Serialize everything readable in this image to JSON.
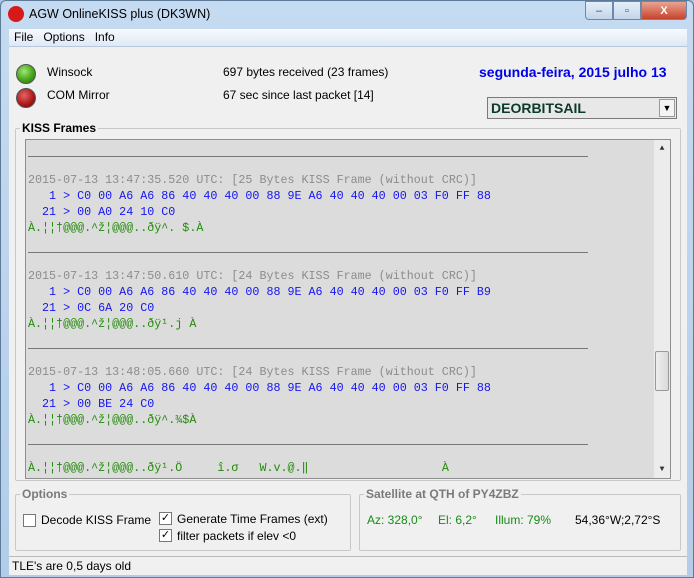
{
  "window": {
    "title": "AGW OnlineKISS plus (DK3WN)",
    "minimize": "–",
    "maximize": "▫",
    "close": "X"
  },
  "menu": [
    "File",
    "Options",
    "Info"
  ],
  "status_panel": {
    "winsock_label": "Winsock",
    "com_label": "COM Mirror",
    "bytes_received": "697 bytes received (23 frames)",
    "since_last": "67 sec since last packet [14]",
    "date": "segunda-feira, 2015 julho 13",
    "satellite_select": "DEORBITSAIL"
  },
  "kiss_frames": {
    "legend": "KISS Frames",
    "frames": [
      {
        "header": "2015-07-13 13:47:35.520 UTC: [25 Bytes KISS Frame (without CRC)]",
        "hex1": "   1 > C0 00 A6 A6 86 40 40 40 00 88 9E A6 40 40 40 00 03 F0 FF 88",
        "hex2": "  21 > 00 A0 24 10 C0",
        "ascii": "À.¦¦†@@@.^ž¦@@@..ðÿ^. $.À"
      },
      {
        "header": "2015-07-13 13:47:50.610 UTC: [24 Bytes KISS Frame (without CRC)]",
        "hex1": "   1 > C0 00 A6 A6 86 40 40 40 00 88 9E A6 40 40 40 00 03 F0 FF B9",
        "hex2": "  21 > 0C 6A 20 C0",
        "ascii": "À.¦¦†@@@.^ž¦@@@..ðÿ¹.j À"
      },
      {
        "header": "2015-07-13 13:48:05.660 UTC: [24 Bytes KISS Frame (without CRC)]",
        "hex1": "   1 > C0 00 A6 A6 86 40 40 40 00 88 9E A6 40 40 40 00 03 F0 FF 88",
        "hex2": "  21 > 00 BE 24 C0",
        "ascii": "À.¦¦†@@@.^ž¦@@@..ðÿ^.¾$À"
      }
    ],
    "partial_line": "À.¦¦†@@@.^ž¦@@@..ðÿ¹.Ö     î.σ   W.v.@.‖                   À"
  },
  "options": {
    "legend": "Options",
    "decode_kiss": {
      "label": "Decode KISS Frame",
      "checked": false
    },
    "gen_time": {
      "label": "Generate Time Frames (ext)",
      "checked": true
    },
    "filter": {
      "label": "filter packets if elev <0",
      "checked": true
    }
  },
  "satellite": {
    "legend": "Satellite at QTH of PY4ZBZ",
    "az": "Az: 328,0°",
    "el": "El: 6,2°",
    "illum": "Illum: 79%",
    "pos": "54,36°W;2,72°S"
  },
  "statusbar": "TLE's are 0,5 days old"
}
